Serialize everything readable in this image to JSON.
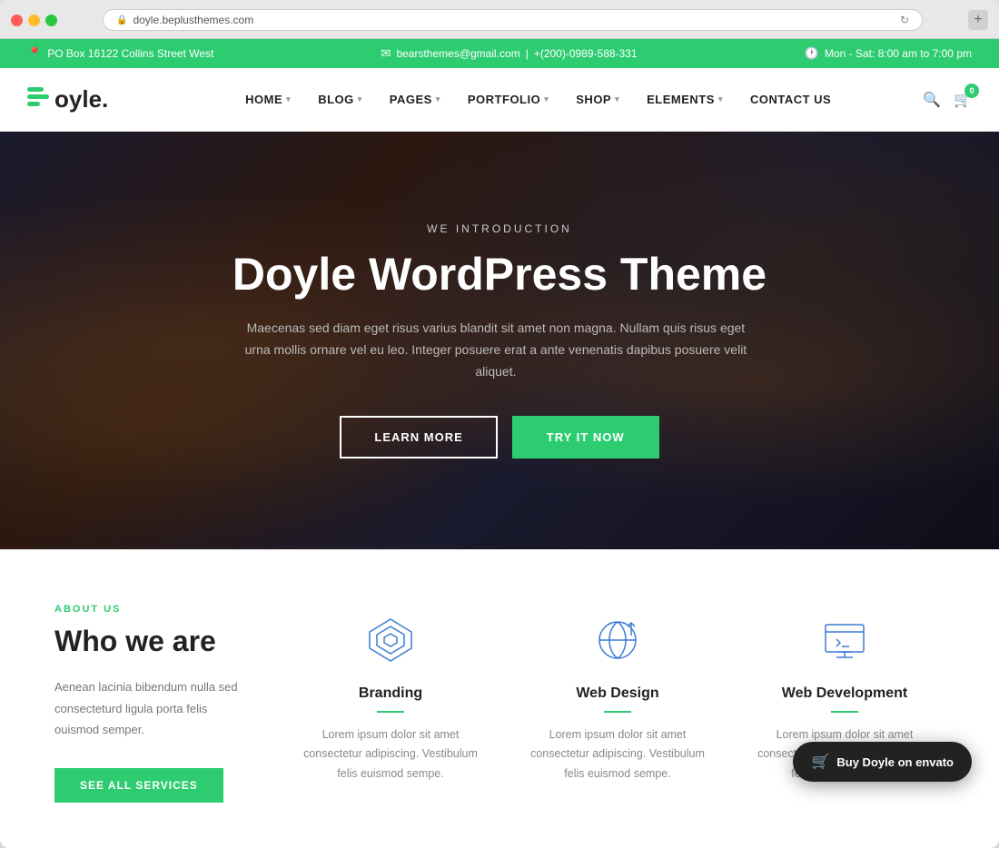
{
  "browser": {
    "url": "doyle.beplusthemes.com",
    "new_tab_label": "+"
  },
  "info_bar": {
    "address": "PO Box 16122 Collins Street West",
    "email": "bearsthemes@gmail.com",
    "phone": "+(200)-0989-588-331",
    "hours": "Mon - Sat: 8:00 am to 7:00 pm"
  },
  "nav": {
    "logo_text": "oyle.",
    "logo_icon": "B",
    "menu_items": [
      {
        "label": "HOME",
        "has_arrow": true
      },
      {
        "label": "BLOG",
        "has_arrow": true
      },
      {
        "label": "PAGES",
        "has_arrow": true
      },
      {
        "label": "PORTFOLIO",
        "has_arrow": true
      },
      {
        "label": "SHOP",
        "has_arrow": true
      },
      {
        "label": "ELEMENTS",
        "has_arrow": true
      },
      {
        "label": "CONTACT US",
        "has_arrow": false
      }
    ],
    "cart_count": "0"
  },
  "hero": {
    "eyebrow": "WE INTRODUCTION",
    "title": "Doyle WordPress Theme",
    "description": "Maecenas sed diam eget risus varius blandit sit amet non magna. Nullam quis risus eget urna mollis ornare vel eu leo. Integer posuere erat a ante venenatis dapibus posuere velit aliquet.",
    "btn_learn_more": "LEARN MORE",
    "btn_try_it": "TRY IT NOW"
  },
  "about": {
    "label": "ABOUT US",
    "title": "Who we are",
    "description": "Aenean lacinia bibendum nulla sed consecteturd ligula porta felis ouismod semper.",
    "btn_label": "SEE ALL SERVICES"
  },
  "services": [
    {
      "icon": "diamond",
      "title": "Branding",
      "description": "Lorem ipsum dolor sit amet consectetur adipiscing. Vestibulum felis euismod sempe."
    },
    {
      "icon": "web-design",
      "title": "Web Design",
      "description": "Lorem ipsum dolor sit amet consectetur adipiscing. Vestibulum felis euismod sempe."
    },
    {
      "icon": "web-dev",
      "title": "Web Development",
      "description": "Lorem ipsum dolor sit amet consectetur adipiscing. Vestibulum felis euismod sempe."
    }
  ],
  "buy_badge": {
    "label": "Buy Doyle on",
    "platform": "envato"
  }
}
